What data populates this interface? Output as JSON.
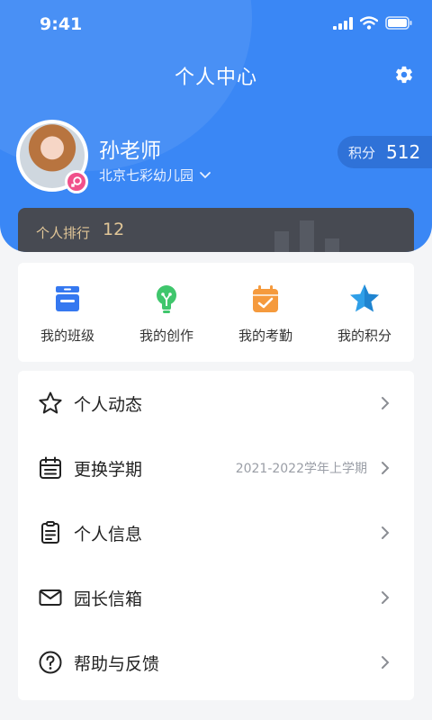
{
  "status_bar": {
    "time": "9:41",
    "icons": [
      "signal-icon",
      "wifi-icon",
      "battery-icon"
    ]
  },
  "header": {
    "title": "个人中心",
    "settings_icon": "gear-icon",
    "background_color": "#3a87f5"
  },
  "profile": {
    "name": "孙老师",
    "school": "北京七彩幼儿园",
    "gender_badge_icon": "female-icon",
    "points_label": "积分",
    "points_value": "512"
  },
  "rank": {
    "label": "个人排行",
    "value": "12"
  },
  "quick_actions": [
    {
      "label": "我的班级",
      "icon": "class-icon",
      "color": "#3578f0"
    },
    {
      "label": "我的创作",
      "icon": "bulb-icon",
      "color": "#3fc66c"
    },
    {
      "label": "我的考勤",
      "icon": "calendar-check-icon",
      "color": "#f59a3d"
    },
    {
      "label": "我的积分",
      "icon": "star-icon",
      "color": "#2f9fe8"
    }
  ],
  "menu": [
    {
      "label": "个人动态",
      "icon": "star-outline-icon",
      "value": ""
    },
    {
      "label": "更换学期",
      "icon": "calendar-icon",
      "value": "2021-2022学年上学期"
    },
    {
      "label": "个人信息",
      "icon": "clipboard-icon",
      "value": ""
    },
    {
      "label": "园长信箱",
      "icon": "mail-icon",
      "value": ""
    },
    {
      "label": "帮助与反馈",
      "icon": "help-icon",
      "value": ""
    }
  ]
}
